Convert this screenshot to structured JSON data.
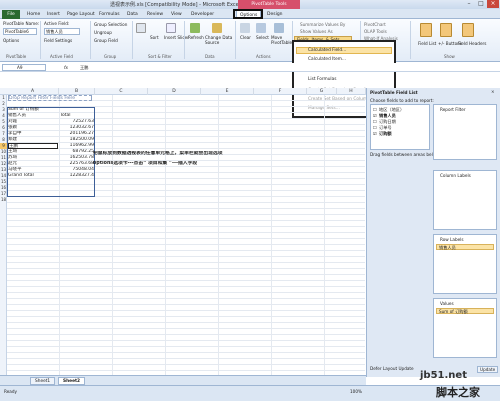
{
  "window": {
    "title": "透视表示例.xls [Compatibility Mode] - Microsoft Excel",
    "tools_label": "PivotTable Tools"
  },
  "menu": {
    "file": "File",
    "tabs": [
      "Home",
      "Insert",
      "Page Layout",
      "Formulas",
      "Data",
      "Review",
      "View",
      "Developer"
    ],
    "options": "Options",
    "design": "Design"
  },
  "ribbon": {
    "pt_name_label": "PivotTable Name:",
    "pt_name_value": "PivotTable6",
    "active_field_label": "Active Field:",
    "active_field_value": "销售人员",
    "options_btn": "Options",
    "field_settings": "Field Settings",
    "group_selection": "Group Selection",
    "ungroup": "Ungroup",
    "group_field": "Group Field",
    "sort_label": "Sort",
    "insert_slicer": "Insert Slicer",
    "refresh": "Refresh",
    "change_source": "Change Data Source",
    "clear": "Clear",
    "select": "Select",
    "move": "Move PivotTable",
    "summarize": "Summarize Values By",
    "show_values": "Show Values As",
    "fields_items_sets": "Fields, Items, & Sets",
    "pivotchart": "PivotChart",
    "olap": "OLAP Tools",
    "whatif": "What-If Analysis",
    "field_list": "Field List",
    "buttons": "+/- Buttons",
    "field_headers": "Field Headers",
    "groups": [
      "PivotTable",
      "Active Field",
      "Group",
      "Sort & Filter",
      "Data",
      "Actions",
      "Calculations",
      "Tools",
      "Show"
    ]
  },
  "dropdown": {
    "items": [
      "Calculated Field...",
      "Calculated Item...",
      "Solve Order...",
      "List Formulas",
      "Create Set Based on Row Items...",
      "Create Set Based on Column Items...",
      "Manage Sets..."
    ]
  },
  "formula": {
    "namebox": "A9",
    "fx": "fx",
    "value": "王鹏"
  },
  "columns": [
    "A",
    "B",
    "C",
    "D",
    "E",
    "F",
    "G",
    "H"
  ],
  "sheet": {
    "filter_hint": "Drop Report Filter Fields Here",
    "header_sum": "Sum of 订购额",
    "header_row": "销售人员",
    "header_total": "Total",
    "rows": [
      {
        "name": "刘霞",
        "value": "72527.63"
      },
      {
        "name": "张颖",
        "value": "123032.67"
      },
      {
        "name": "李自中",
        "value": "201196.27"
      },
      {
        "name": "郑建",
        "value": "182500.09"
      },
      {
        "name": "王鹏",
        "value": "116962.99"
      },
      {
        "name": "王琦",
        "value": "68792.25"
      },
      {
        "name": "苏琦",
        "value": "162503.78"
      },
      {
        "name": "赵元",
        "value": "225763.68"
      },
      {
        "name": "马晓平",
        "value": "75048.04"
      }
    ],
    "grand_total_label": "Grand Total",
    "grand_total_value": "1228327.4",
    "instruction_line1": "把鼠标放到数据透视表的任意单元格上，菜单栏就会出现选项",
    "instruction_line2": "options选项卡---点击“ 项目和集 ”---插入字段"
  },
  "fieldlist": {
    "title": "PivotTable Field List",
    "choose": "Choose fields to add to report:",
    "fields": [
      {
        "label": "地区（地区）",
        "checked": false
      },
      {
        "label": "销售人员",
        "checked": true
      },
      {
        "label": "订购日期",
        "checked": false
      },
      {
        "label": "订单号",
        "checked": false
      },
      {
        "label": "订购额",
        "checked": true
      }
    ],
    "drag_hint": "Drag fields between areas below:",
    "report_filter": "Report Filter",
    "column_labels": "Column Labels",
    "row_labels": "Row Labels",
    "row_item": "销售人员",
    "values": "Values",
    "values_item": "Sum of 订购额",
    "defer": "Defer Layout Update",
    "update": "Update"
  },
  "sheets": [
    "Sheet1",
    "Sheet2"
  ],
  "status": {
    "ready": "Ready",
    "zoom": "100%"
  },
  "watermark": {
    "url": "jb51.net",
    "brand": "脚本之家"
  }
}
